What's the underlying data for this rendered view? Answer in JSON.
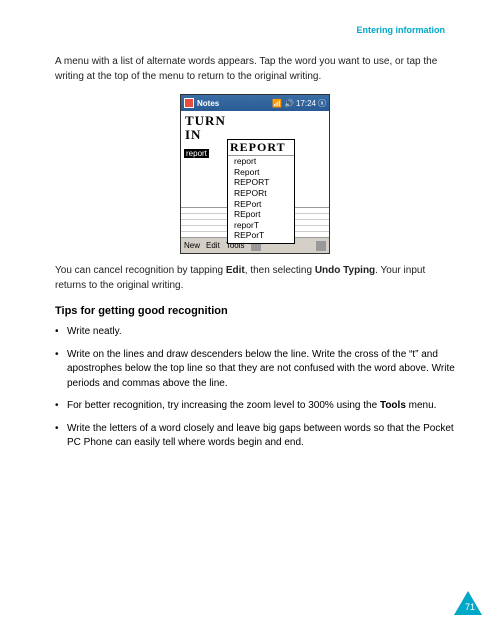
{
  "header": {
    "section_link": "Entering information"
  },
  "para1": "A menu with a list of alternate words appears. Tap the word you want to use, or tap the writing at the top of the menu to return to the original writing.",
  "pda": {
    "title": "Notes",
    "time": "17:24",
    "hand_line1": "TURN",
    "hand_line2": "IN",
    "selected": "report",
    "popup_head": "REPORT",
    "popup_items": [
      "report",
      "Report",
      "REPORT",
      "REPORt",
      "REPort",
      "REport",
      "reporT",
      "REPorT"
    ],
    "menu": {
      "new": "New",
      "edit": "Edit",
      "tools": "Tools"
    }
  },
  "para2_pre": "You can cancel recognition by tapping ",
  "para2_b1": "Edit",
  "para2_mid": ", then selecting ",
  "para2_b2": "Undo Typing",
  "para2_post": ". Your input returns to the original writing.",
  "tips_heading": "Tips for getting good recognition",
  "tips": [
    {
      "text": "Write neatly."
    },
    {
      "text": "Write on the lines and draw descenders below the line. Write the cross of the “t” and apostrophes below the top line so that they are not confused with the word above. Write periods and commas above the line."
    },
    {
      "pre": "For better recognition, try increasing the zoom level to 300% using the ",
      "b": "Tools",
      "post": " menu."
    },
    {
      "text": "Write the letters of a word closely and leave big gaps between words so that the Pocket PC Phone can easily tell where words begin and end."
    }
  ],
  "page_number": "71"
}
